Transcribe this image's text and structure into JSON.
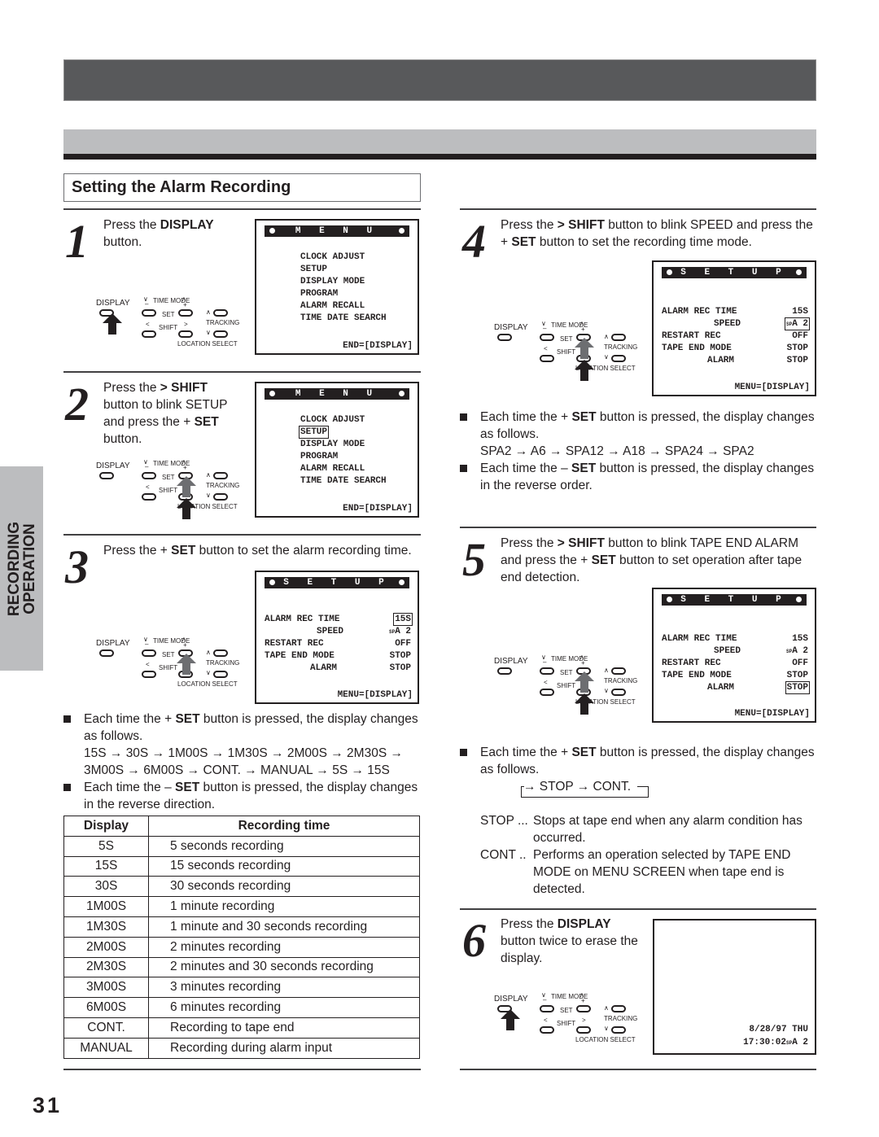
{
  "page": {
    "number": "31",
    "side_tab": [
      "RECORDING",
      "OPERATION"
    ],
    "section_title": "Setting the Alarm Recording"
  },
  "remote_labels": {
    "display": "DISPLAY",
    "time_mode": "TIME MODE",
    "set": "SET",
    "shift": "SHIFT",
    "tracking": "TRACKING",
    "location_select": "LOCATION SELECT",
    "minus": "–",
    "plus": "+",
    "lt": "<",
    "gt": ">"
  },
  "steps": [
    {
      "num": "1",
      "parts": [
        {
          "t": "Press the "
        },
        {
          "b": "DISPLAY"
        },
        {
          "t": " button."
        }
      ],
      "screen": {
        "title": "M E N U",
        "lines": [
          "CLOCK ADJUST",
          "SETUP",
          "DISPLAY MODE",
          "PROGRAM",
          "ALARM RECALL",
          "TIME DATE SEARCH"
        ],
        "footer": "END=[DISPLAY]",
        "highlight": null
      },
      "pressed": [
        "display"
      ]
    },
    {
      "num": "2",
      "parts": [
        {
          "t": "Press the "
        },
        {
          "b": "> SHIFT"
        },
        {
          "t": " button to blink SETUP and press the + "
        },
        {
          "b": "SET"
        },
        {
          "t": " button."
        }
      ],
      "screen": {
        "title": "M E N U",
        "lines": [
          "CLOCK ADJUST",
          "SETUP",
          "DISPLAY MODE",
          "PROGRAM",
          "ALARM RECALL",
          "TIME DATE SEARCH"
        ],
        "footer": "END=[DISPLAY]",
        "highlight": "SETUP"
      },
      "pressed": [
        "set_plus",
        "shift_right"
      ]
    },
    {
      "num": "3",
      "parts": [
        {
          "t": "Press the + "
        },
        {
          "b": "SET"
        },
        {
          "t": " button to set the alarm recording time."
        }
      ],
      "screen": {
        "title": "S E T U P",
        "rows": [
          {
            "label": "ALARM REC TIME",
            "value": "15S"
          },
          {
            "label": "SPEED",
            "value": "SPA 2"
          },
          {
            "label": "RESTART REC",
            "value": "OFF"
          },
          {
            "label": "TAPE END MODE",
            "value": "STOP"
          },
          {
            "label": "ALARM",
            "value": "STOP"
          }
        ],
        "footer": "MENU=[DISPLAY]",
        "highlight": "ALARM REC TIME"
      },
      "pressed": [
        "set_plus"
      ]
    },
    {
      "num": "4",
      "parts": [
        {
          "t": "Press the "
        },
        {
          "b": "> SHIFT"
        },
        {
          "t": " button to blink SPEED and press the + "
        },
        {
          "b": "SET"
        },
        {
          "t": " button to set the recording time mode."
        }
      ],
      "screen": {
        "title": "S E T U P",
        "rows": [
          {
            "label": "ALARM REC TIME",
            "value": "15S"
          },
          {
            "label": "SPEED",
            "value": "SPA 2"
          },
          {
            "label": "RESTART REC",
            "value": "OFF"
          },
          {
            "label": "TAPE END MODE",
            "value": "STOP"
          },
          {
            "label": "ALARM",
            "value": "STOP"
          }
        ],
        "footer": "MENU=[DISPLAY]",
        "highlight": "SPEED"
      },
      "pressed": [
        "set_plus",
        "shift_right"
      ]
    },
    {
      "num": "5",
      "parts": [
        {
          "t": "Press the "
        },
        {
          "b": "> SHIFT"
        },
        {
          "t": " button to blink TAPE END ALARM and press the + "
        },
        {
          "b": "SET"
        },
        {
          "t": " button to set operation after tape end detection."
        }
      ],
      "screen": {
        "title": "S E T U P",
        "rows": [
          {
            "label": "ALARM REC TIME",
            "value": "15S"
          },
          {
            "label": "SPEED",
            "value": "SPA 2"
          },
          {
            "label": "RESTART REC",
            "value": "OFF"
          },
          {
            "label": "TAPE END MODE",
            "value": "STOP"
          },
          {
            "label": "ALARM",
            "value": "STOP"
          }
        ],
        "footer": "MENU=[DISPLAY]",
        "highlight": "ALARM"
      },
      "pressed": [
        "set_plus",
        "shift_right"
      ]
    },
    {
      "num": "6",
      "parts": [
        {
          "t": "Press the "
        },
        {
          "b": "DISPLAY"
        },
        {
          "t": " button twice to erase the display."
        }
      ],
      "screen": {
        "date": "8/28/97 THU",
        "time": "17:30:02",
        "speed": "SPA 2"
      },
      "pressed": [
        "display"
      ]
    }
  ],
  "notes_step3": [
    {
      "parts": [
        {
          "t": "Each time the + "
        },
        {
          "b": "SET"
        },
        {
          "t": " button is pressed, the display changes as follows."
        }
      ],
      "sequence": [
        "15S → 30S → 1M00S → 1M30S → 2M00S → 2M30S →",
        "3M00S → 6M00S → CONT. → MANUAL → 5S → 15S"
      ]
    },
    {
      "parts": [
        {
          "t": "Each time the – "
        },
        {
          "b": "SET"
        },
        {
          "t": " button is pressed, the display changes in the reverse direction."
        }
      ]
    }
  ],
  "table": {
    "headers": [
      "Display",
      "Recording time"
    ],
    "rows": [
      [
        "5S",
        "5 seconds recording"
      ],
      [
        "15S",
        "15 seconds recording"
      ],
      [
        "30S",
        "30 seconds recording"
      ],
      [
        "1M00S",
        "1 minute recording"
      ],
      [
        "1M30S",
        "1 minute and 30 seconds recording"
      ],
      [
        "2M00S",
        "2 minutes recording"
      ],
      [
        "2M30S",
        "2 minutes and 30 seconds recording"
      ],
      [
        "3M00S",
        "3 minutes recording"
      ],
      [
        "6M00S",
        "6 minutes recording"
      ],
      [
        "CONT.",
        "Recording to tape end"
      ],
      [
        "MANUAL",
        "Recording during alarm input"
      ]
    ]
  },
  "notes_step4": [
    {
      "parts": [
        {
          "t": "Each time the + "
        },
        {
          "b": "SET"
        },
        {
          "t": " button is pressed, the display changes as follows."
        }
      ],
      "sequence": [
        "SPA2 → A6 → SPA12 → A18 → SPA24 → SPA2"
      ]
    },
    {
      "parts": [
        {
          "t": "Each time the – "
        },
        {
          "b": "SET"
        },
        {
          "t": " button is pressed, the display changes in the reverse order."
        }
      ]
    }
  ],
  "notes_step5": {
    "intro": [
      {
        "t": "Each time the + "
      },
      {
        "b": "SET"
      },
      {
        "t": " button is pressed, the display changes as follows."
      }
    ],
    "cycle": "→ STOP → CONT.",
    "definitions": [
      {
        "term": "STOP ...",
        "desc": "Stops at tape end when any alarm condition has occurred."
      },
      {
        "term": "CONT ..",
        "desc": "Performs an operation selected by TAPE END MODE on MENU SCREEN when tape end is detected."
      }
    ]
  }
}
